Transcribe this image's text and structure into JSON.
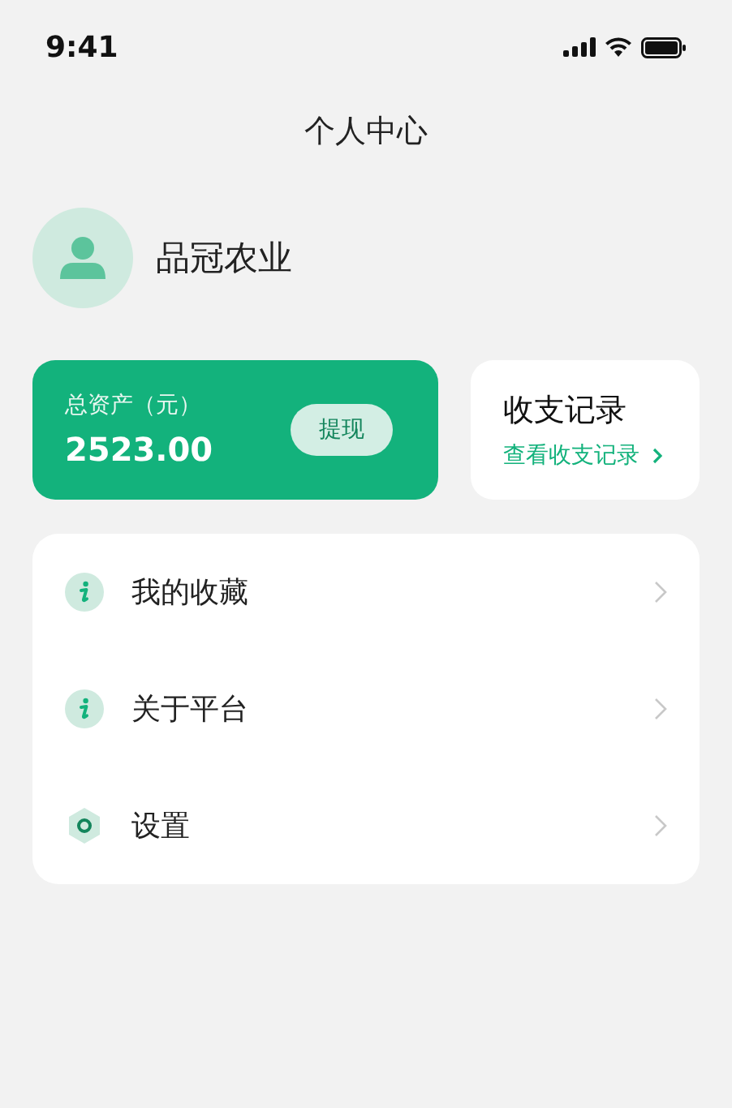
{
  "status_bar": {
    "time": "9:41"
  },
  "header": {
    "title": "个人中心"
  },
  "profile": {
    "name": "品冠农业"
  },
  "assets": {
    "label": "总资产（元）",
    "amount": "2523.00",
    "button": "提现"
  },
  "records": {
    "title": "收支记录",
    "link": "查看收支记录"
  },
  "menu": [
    {
      "kind": "info",
      "label": "我的收藏"
    },
    {
      "kind": "info",
      "label": "关于平台"
    },
    {
      "kind": "settings",
      "label": "设置"
    }
  ]
}
